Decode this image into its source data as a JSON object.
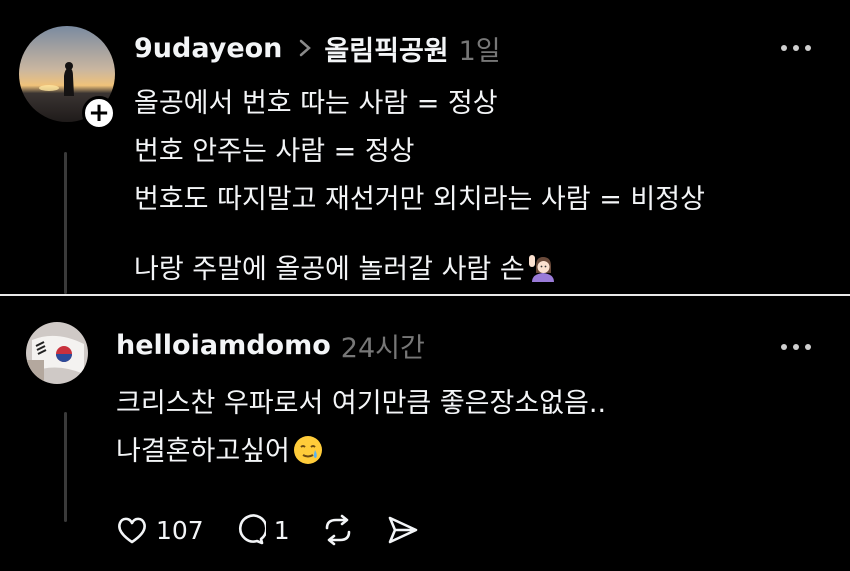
{
  "post": {
    "username": "9udayeon",
    "community": "올림픽공원",
    "time": "1일",
    "lines": [
      "올공에서 번호 따는 사람 = 정상",
      "번호 안주는 사람 = 정상",
      "번호도 따지말고 재선거만 외치라는 사람 = 비정상",
      "나랑 주말에 올공에 놀러갈 사람 손"
    ],
    "avatar_icon": "sunset-silhouette-avatar",
    "follow_icon": "plus-icon"
  },
  "reply": {
    "username": "helloiamdomo",
    "time": "24시간",
    "lines": [
      "크리스찬 우파로서 여기만큼 좋은장소없음..",
      "나결혼하고싶어"
    ],
    "likes": "107",
    "comments": "1",
    "avatar_icon": "flag-avatar"
  },
  "colors": {
    "background": "#000000",
    "text": "#f3f5f7",
    "muted": "#777777"
  }
}
